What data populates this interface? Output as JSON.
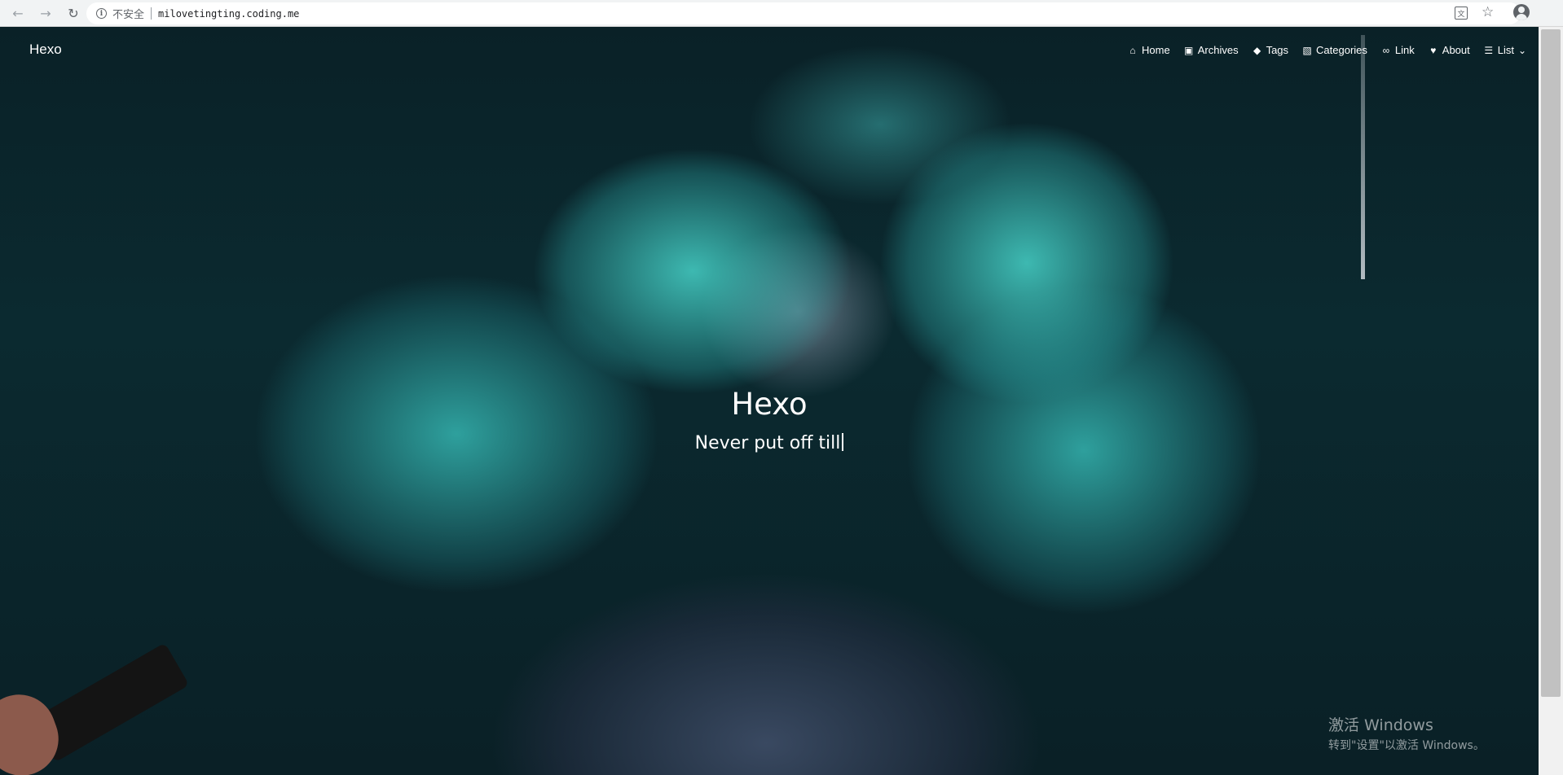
{
  "browser": {
    "back_icon": "arrow-left-icon",
    "forward_icon": "arrow-right-icon",
    "reload_icon": "reload-icon",
    "security_label": "不安全",
    "url": "milovetingting.coding.me",
    "translate_icon": "translate-icon",
    "bookmark_icon": "star-icon",
    "account_icon": "account-icon"
  },
  "site": {
    "brand": "Hexo",
    "nav": [
      {
        "label": "Home",
        "icon": "home-icon"
      },
      {
        "label": "Archives",
        "icon": "archive-icon"
      },
      {
        "label": "Tags",
        "icon": "tags-icon"
      },
      {
        "label": "Categories",
        "icon": "folder-open-icon"
      },
      {
        "label": "Link",
        "icon": "link-icon"
      },
      {
        "label": "About",
        "icon": "heart-icon"
      },
      {
        "label": "List",
        "icon": "list-icon"
      }
    ]
  },
  "hero": {
    "title": "Hexo",
    "subtitle": "Never put off till"
  },
  "os_overlay": {
    "line1": "激活 Windows",
    "line2": "转到\"设置\"以激活 Windows。"
  }
}
